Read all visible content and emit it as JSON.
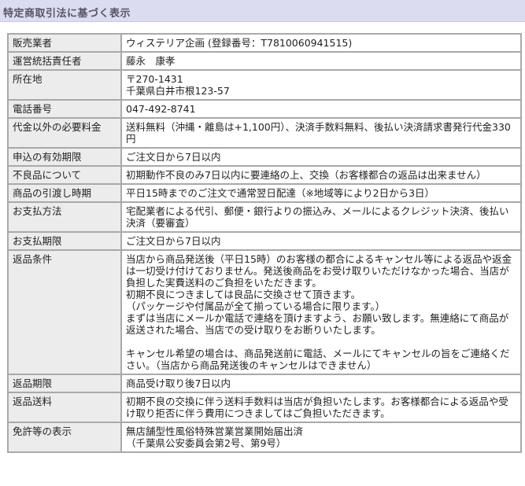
{
  "header": {
    "title": "特定商取引法に基づく表示"
  },
  "rows": [
    {
      "label": "販売業者",
      "lines": [
        "ウィステリア企画 (登録番号：T7810060941515)"
      ]
    },
    {
      "label": "運営統括責任者",
      "lines": [
        "藤永　康孝"
      ]
    },
    {
      "label": "所在地",
      "lines": [
        "〒270-1431",
        "千葉県白井市根123-57"
      ]
    },
    {
      "label": "電話番号",
      "lines": [
        "047-492-8741"
      ]
    },
    {
      "label": "代金以外の必要料金",
      "lines": [
        "送料無料（沖縄・離島は+1,100円）、決済手数料無料、後払い決済請求書発行代金330円"
      ]
    },
    {
      "label": "申込の有効期限",
      "lines": [
        "ご注文日から7日以内"
      ]
    },
    {
      "label": "不良品について",
      "lines": [
        "初期動作不良のみ7日以内に要連絡の上、交換（お客様都合の返品は出来ません）"
      ]
    },
    {
      "label": "商品の引渡し時期",
      "lines": [
        "平日15時までのご注文で通常翌日配達（※地域等により2日から3日）"
      ]
    },
    {
      "label": "お支払方法",
      "lines": [
        "宅配業者による代引、郵便・銀行よりの振込み、メールによるクレジット決済、後払い決済（要審査）"
      ]
    },
    {
      "label": "お支払期限",
      "lines": [
        "ご注文日から7日以内"
      ]
    },
    {
      "label": "返品条件",
      "lines": [
        "当店から商品発送後（平日15時）のお客様の都合によるキャンセル等による返品や返金は一切受け付けておりません。発送後商品をお受け取りいただけなかった場合、当店が負担した実費送料のご負担をいただきます。",
        "初期不良につきましては良品に交換させて頂きます。",
        "（パッケージや付属品が全て揃っている場合に限ります。）",
        "まずは当店にメールか電話で連絡を頂けますよう、お願い致します。無連絡にて商品が返送された場合、当店での受け取りをお断りいたします。",
        "",
        "キャンセル希望の場合は、商品発送前に電話、メールにてキャンセルの旨をご連絡ください。（当店から商品発送後のキャンセルはできません）"
      ]
    },
    {
      "label": "返品期限",
      "lines": [
        "商品受け取り後7日以内"
      ]
    },
    {
      "label": "返品送料",
      "lines": [
        "初期不良の交換に伴う送料手数料は当店が負担いたします。お客様都合による返品や受け取り拒否に伴う費用につきましてはご負担いただきます。"
      ]
    },
    {
      "label": "免許等の表示",
      "lines": [
        "無店舗型性風俗特殊営業営業開始届出済",
        "（千葉県公安委員会第2号、第9号）"
      ]
    }
  ]
}
